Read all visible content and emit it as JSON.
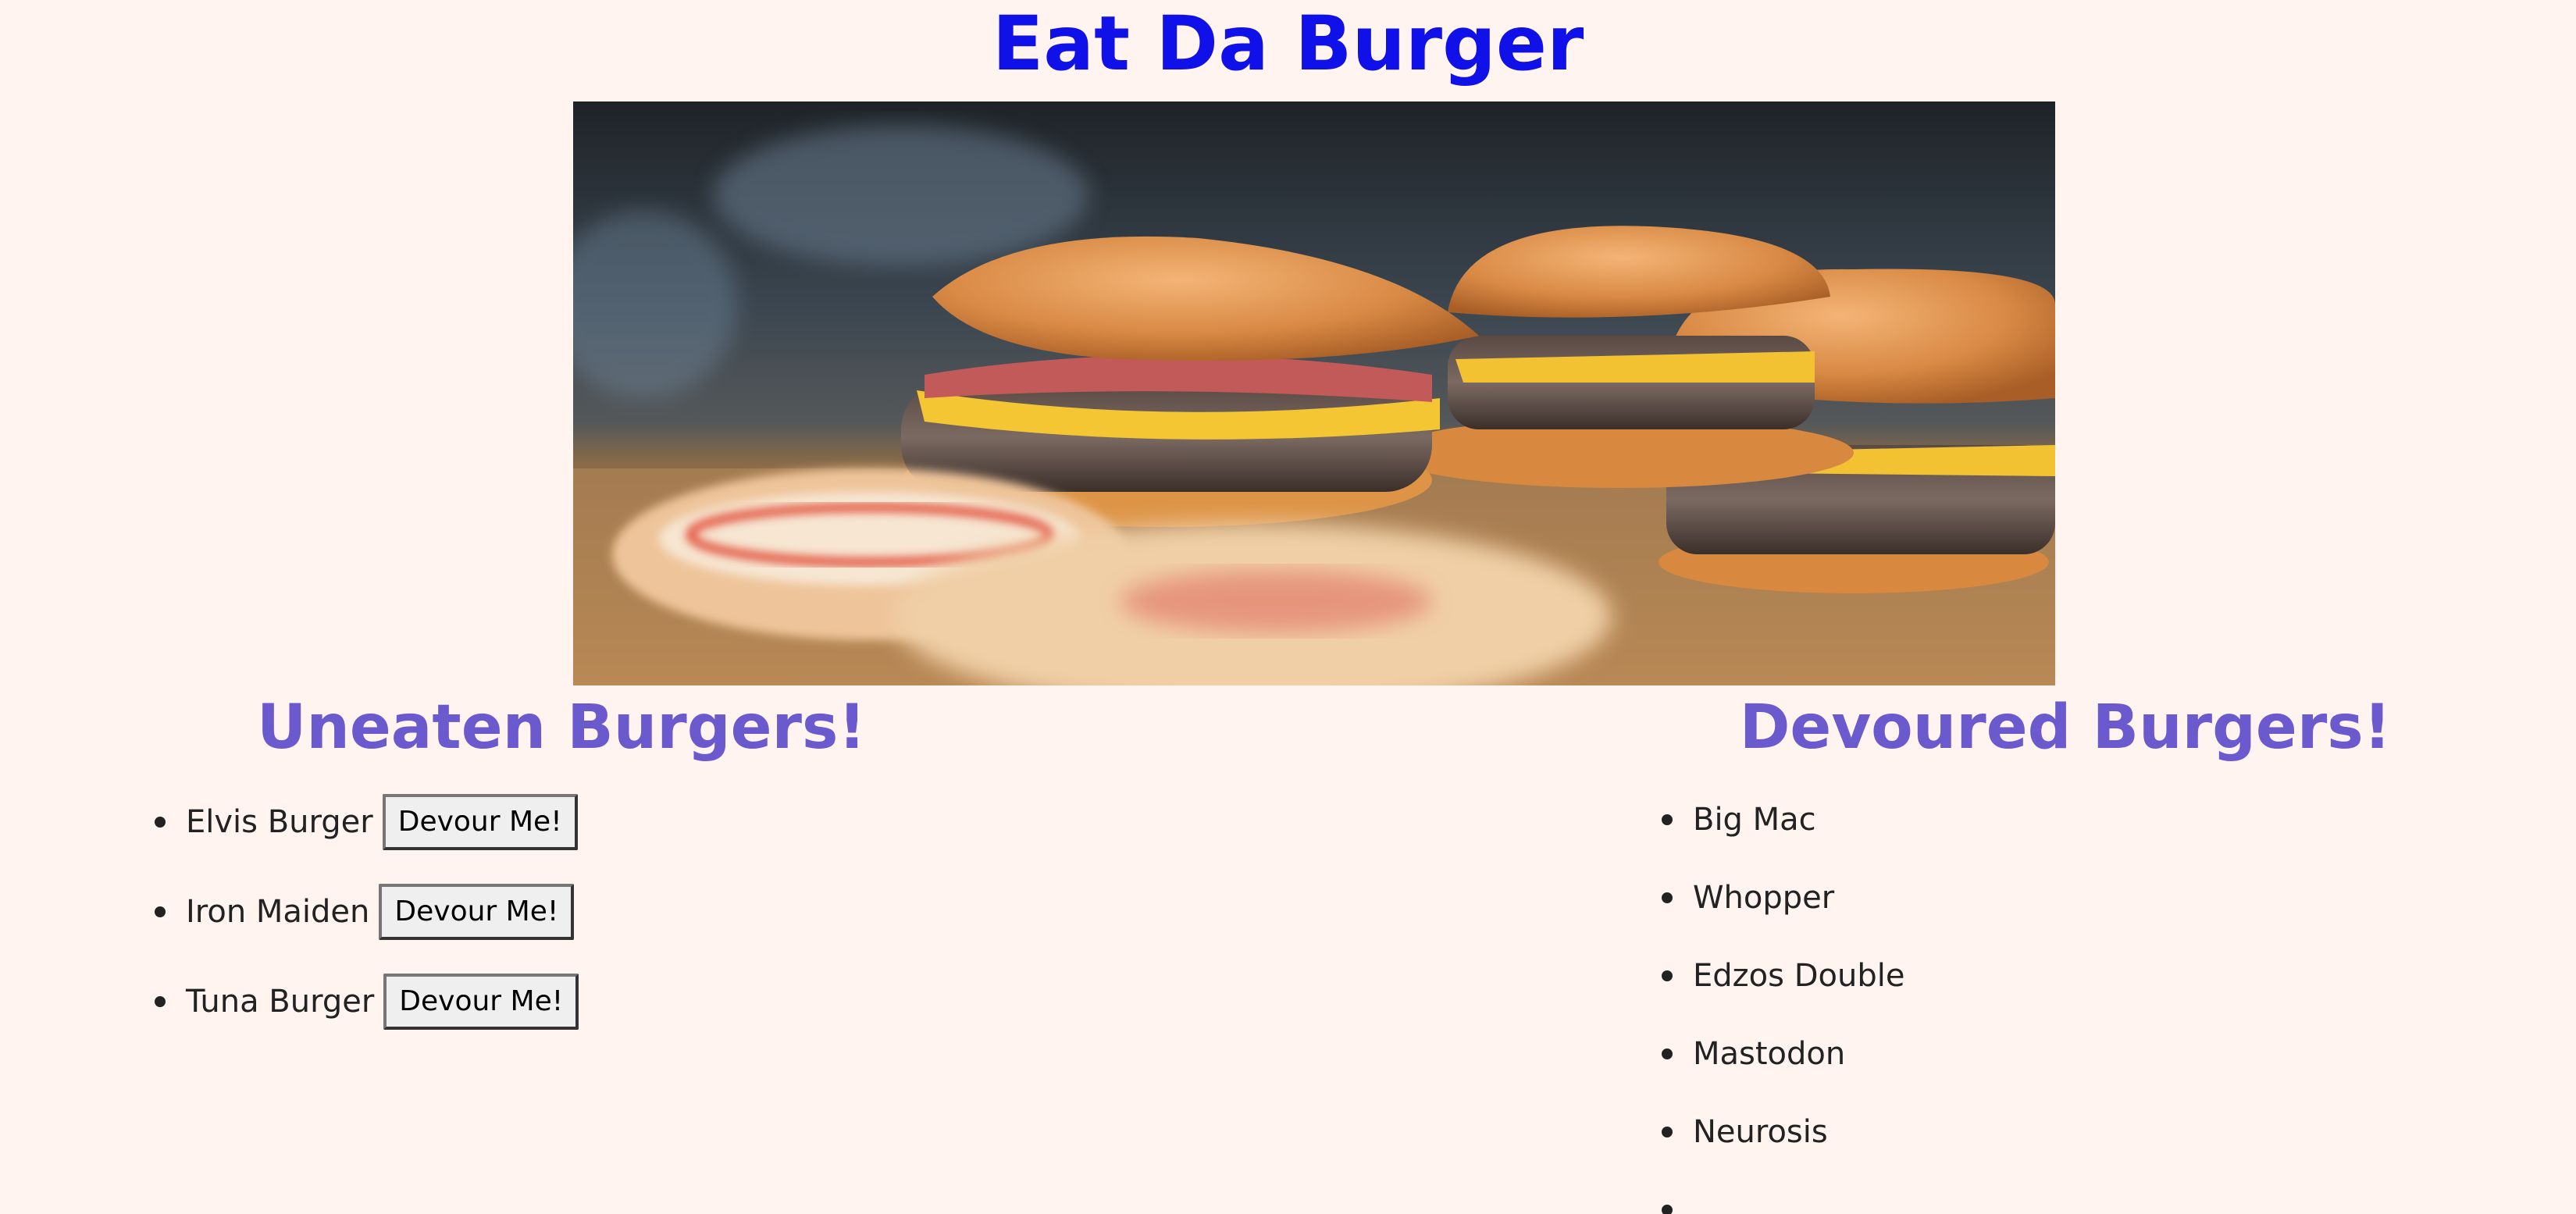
{
  "header": {
    "title": "Eat Da Burger"
  },
  "hero": {
    "image": "burgers-photo"
  },
  "uneaten": {
    "heading": "Uneaten Burgers!",
    "button_label": "Devour Me!",
    "items": [
      {
        "name": "Elvis Burger",
        "button": "Devour Me!"
      },
      {
        "name": "Iron Maiden",
        "button": "Devour Me!"
      },
      {
        "name": "Tuna Burger",
        "button": "Devour Me!"
      }
    ]
  },
  "devoured": {
    "heading": "Devoured Burgers!",
    "items": [
      {
        "name": "Big Mac"
      },
      {
        "name": "Whopper"
      },
      {
        "name": "Edzos Double"
      },
      {
        "name": "Mastodon"
      },
      {
        "name": "Neurosis"
      },
      {
        "name": ""
      }
    ]
  },
  "colors": {
    "background": "#fff4ef",
    "title": "#1010e8",
    "section_heading": "#6a5acd"
  }
}
